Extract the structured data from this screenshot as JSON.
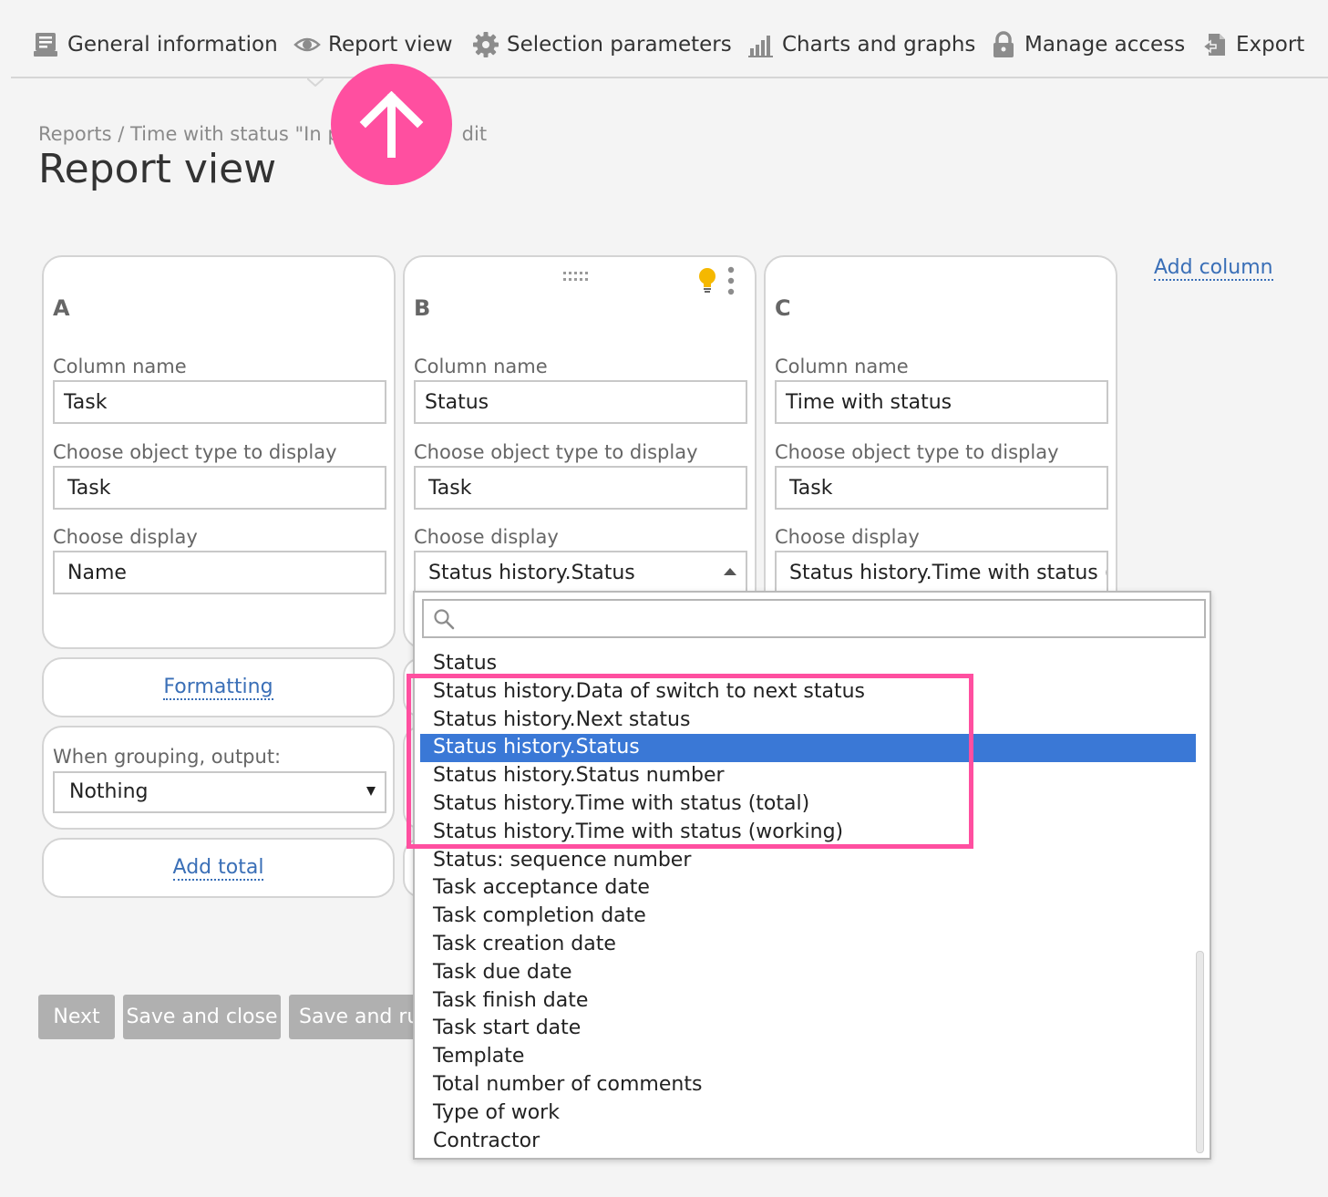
{
  "nav": {
    "items": [
      {
        "label": "General information",
        "icon": "form-icon"
      },
      {
        "label": "Report view",
        "icon": "eye-icon"
      },
      {
        "label": "Selection parameters",
        "icon": "gear-icon"
      },
      {
        "label": "Charts and graphs",
        "icon": "bar-chart-icon"
      },
      {
        "label": "Manage access",
        "icon": "lock-icon"
      },
      {
        "label": "Export",
        "icon": "export-icon"
      }
    ],
    "active": "Report view"
  },
  "header": {
    "breadcrumb_start": "Reports / Time with status \"In p",
    "breadcrumb_end": "dit",
    "title": "Report view"
  },
  "columns": [
    {
      "letter": "A",
      "column_name_label": "Column name",
      "column_name": "Task",
      "object_type_label": "Choose object type to display",
      "object_type": "Task",
      "display_label": "Choose display",
      "display": "Name"
    },
    {
      "letter": "B",
      "column_name_label": "Column name",
      "column_name": "Status",
      "object_type_label": "Choose object type to display",
      "object_type": "Task",
      "display_label": "Choose display",
      "display": "Status history.Status"
    },
    {
      "letter": "C",
      "column_name_label": "Column name",
      "column_name": "Time with status",
      "object_type_label": "Choose object type to display",
      "object_type": "Task",
      "display_label": "Choose display",
      "display": "Status history.Time with status (to"
    }
  ],
  "card_a_extras": {
    "formatting_link": "Formatting",
    "grouping_label": "When grouping, output:",
    "grouping_value": "Nothing",
    "add_total_link": "Add total"
  },
  "add_column": "Add column",
  "buttons": {
    "next": "Next",
    "save_close": "Save and close",
    "save_run": "Save and ru"
  },
  "dropdown": {
    "search_value": "",
    "selected": "Status history.Status",
    "options": [
      "Status",
      "Status history.Data of switch to next status",
      "Status history.Next status",
      "Status history.Status",
      "Status history.Status number",
      "Status history.Time with status (total)",
      "Status history.Time with status (working)",
      "Status: sequence number",
      "Task acceptance date",
      "Task completion date",
      "Task creation date",
      "Task due date",
      "Task finish date",
      "Task start date",
      "Template",
      "Total number of comments",
      "Type of work",
      "Contractor"
    ]
  },
  "colors": {
    "accent_pink": "#ff4fa0",
    "selection_blue": "#3a78d6",
    "link_blue": "#3a6fb7",
    "button_gray": "#b0b0b0",
    "bulb_yellow": "#f5b800"
  }
}
